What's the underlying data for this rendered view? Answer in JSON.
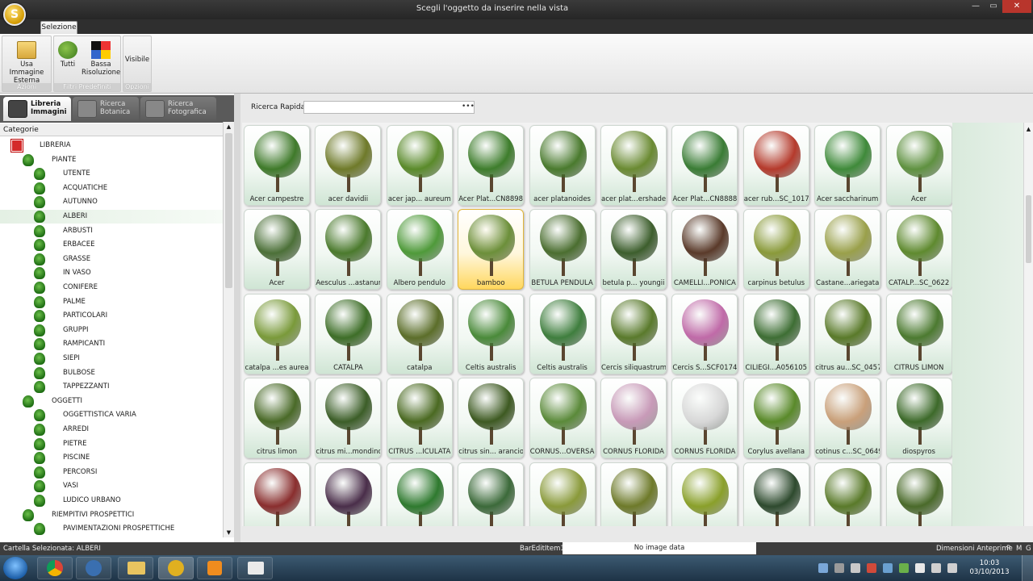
{
  "window": {
    "title": "Scegli l'oggetto da inserire nella vista",
    "min": "—",
    "max": "▭",
    "close": "✕"
  },
  "ribbon": {
    "tab": "Selezione",
    "groups": [
      {
        "label": "Azioni",
        "buttons": [
          {
            "label_1": "Usa Immagine",
            "label_2": "Esterna",
            "icon": "folder-icon"
          }
        ]
      },
      {
        "label": "Filtri Predefiniti",
        "buttons": [
          {
            "label_1": "Tutti",
            "label_2": "",
            "icon": "plants-icon"
          },
          {
            "label_1": "Bassa",
            "label_2": "Risoluzione",
            "icon": "pixel-grid-icon"
          }
        ]
      },
      {
        "label": "Opzioni",
        "buttons": [
          {
            "label_1": "Visibile",
            "label_2": "",
            "icon": "eye-icon"
          }
        ]
      }
    ]
  },
  "panel_tabs": [
    {
      "line_1": "Libreria",
      "line_2": "Immagini",
      "active": true
    },
    {
      "line_1": "Ricerca",
      "line_2": "Botanica",
      "active": false
    },
    {
      "line_1": "Ricerca",
      "line_2": "Fotografica",
      "active": false
    }
  ],
  "tree": {
    "header": "Categorie",
    "root": "LIBRERIA",
    "nodes": [
      {
        "label": "PIANTE",
        "level": 1
      },
      {
        "label": "UTENTE",
        "level": 2
      },
      {
        "label": "ACQUATICHE",
        "level": 2
      },
      {
        "label": "AUTUNNO",
        "level": 2
      },
      {
        "label": "ALBERI",
        "level": 2,
        "selected": true
      },
      {
        "label": "ARBUSTI",
        "level": 2
      },
      {
        "label": "ERBACEE",
        "level": 2
      },
      {
        "label": "GRASSE",
        "level": 2
      },
      {
        "label": "IN VASO",
        "level": 2
      },
      {
        "label": "CONIFERE",
        "level": 2
      },
      {
        "label": "PALME",
        "level": 2
      },
      {
        "label": "PARTICOLARI",
        "level": 2
      },
      {
        "label": "GRUPPI",
        "level": 2
      },
      {
        "label": "RAMPICANTI",
        "level": 2
      },
      {
        "label": "SIEPI",
        "level": 2
      },
      {
        "label": "BULBOSE",
        "level": 2
      },
      {
        "label": "TAPPEZZANTI",
        "level": 2
      },
      {
        "label": "OGGETTI",
        "level": 1
      },
      {
        "label": "OGGETTISTICA VARIA",
        "level": 2
      },
      {
        "label": "ARREDI",
        "level": 2
      },
      {
        "label": "PIETRE",
        "level": 2
      },
      {
        "label": "PISCINE",
        "level": 2
      },
      {
        "label": "PERCORSI",
        "level": 2
      },
      {
        "label": "VASI",
        "level": 2
      },
      {
        "label": "LUDICO URBANO",
        "level": 2
      },
      {
        "label": "RIEMPITIVI PROSPETTICI",
        "level": 1
      },
      {
        "label": "PAVIMENTAZIONI PROSPETTICHE",
        "level": 2
      }
    ]
  },
  "search": {
    "label": "Ricerca Rapida",
    "value": "",
    "dots": "•••"
  },
  "grid": {
    "cards": [
      {
        "label": "Acer campestre",
        "color": "#3f7a2a"
      },
      {
        "label": "acer davidii",
        "color": "#6f7a2a"
      },
      {
        "label": "acer jap... aureum",
        "color": "#5a8a2a"
      },
      {
        "label": "Acer Plat...CN8898",
        "color": "#3e7d2c"
      },
      {
        "label": "acer platanoides",
        "color": "#4a7a2e"
      },
      {
        "label": "acer plat...ershade",
        "color": "#6a8a32"
      },
      {
        "label": "Acer Plat...CN8888",
        "color": "#3a7c35"
      },
      {
        "label": "acer rub...SC_1017",
        "color": "#b53a2c"
      },
      {
        "label": "Acer saccharinum",
        "color": "#3f8a3a"
      },
      {
        "label": "Acer",
        "color": "#5f9140"
      },
      {
        "label": "Acer",
        "color": "#4c7038"
      },
      {
        "label": "Aesculus ...astanum",
        "color": "#4b7a2d"
      },
      {
        "label": "Albero pendulo",
        "color": "#4f9a3a"
      },
      {
        "label": "bamboo",
        "color": "#6c8f3a",
        "selected": true
      },
      {
        "label": "BETULA PENDULA",
        "color": "#4b6e30"
      },
      {
        "label": "betula p... youngii",
        "color": "#3d5e2d"
      },
      {
        "label": "CAMELLI...PONICA",
        "color": "#5a3a2a"
      },
      {
        "label": "carpinus betulus",
        "color": "#8a9a3a"
      },
      {
        "label": "Castane...ariegata",
        "color": "#9aa04a"
      },
      {
        "label": "CATALP...SC_0622",
        "color": "#5f8a2f"
      },
      {
        "label": "catalpa ...es aurea",
        "color": "#7a9a3a"
      },
      {
        "label": "CATALPA",
        "color": "#3e6e28"
      },
      {
        "label": "catalpa",
        "color": "#5c6e2a"
      },
      {
        "label": "Celtis australis",
        "color": "#4a8a3a"
      },
      {
        "label": "Celtis australis",
        "color": "#3f7e3e"
      },
      {
        "label": "Cercis siliquastrum",
        "color": "#5a7a2c"
      },
      {
        "label": "Cercis S...SCF0174",
        "color": "#c06aa8"
      },
      {
        "label": "CILIEGI...A056105",
        "color": "#3e6e34"
      },
      {
        "label": "citrus au...SC_0457",
        "color": "#5a7a2a"
      },
      {
        "label": "CITRUS LIMON",
        "color": "#4c7a30"
      },
      {
        "label": "citrus limon",
        "color": "#4a6a28"
      },
      {
        "label": "citrus mi...mondino",
        "color": "#3c5e28"
      },
      {
        "label": "CITRUS ...ICULATA",
        "color": "#4b6a22"
      },
      {
        "label": "citrus sin... arancio",
        "color": "#3e5a22"
      },
      {
        "label": "CORNUS...OVERSA",
        "color": "#5b8a3a"
      },
      {
        "label": "CORNUS FLORIDA",
        "color": "#c89ab8"
      },
      {
        "label": "CORNUS FLORIDA",
        "color": "#d8d8d8"
      },
      {
        "label": "Corylus avellana",
        "color": "#5a8a2a"
      },
      {
        "label": "cotinus c...SC_0649",
        "color": "#c9a07a"
      },
      {
        "label": "diospyros",
        "color": "#3d6a2a"
      },
      {
        "label": "",
        "color": "#8a2e2e"
      },
      {
        "label": "",
        "color": "#4a2e4a"
      },
      {
        "label": "",
        "color": "#2f7a2f"
      },
      {
        "label": "",
        "color": "#3c6a3a"
      },
      {
        "label": "",
        "color": "#8a9a3a"
      },
      {
        "label": "",
        "color": "#6e7a2a"
      },
      {
        "label": "",
        "color": "#8aa02a"
      },
      {
        "label": "",
        "color": "#2e4a2e"
      },
      {
        "label": "",
        "color": "#5a7a2a"
      },
      {
        "label": "",
        "color": "#4a6a2a"
      }
    ]
  },
  "status": {
    "folder": "Cartella Selezionata: ALBERI",
    "bar_item": "BarEditItem1",
    "image_data": "No image data",
    "dim_label": "Dimensioni Anteprime",
    "size_p": "P",
    "size_m": "M",
    "size_g": "G"
  },
  "taskbar": {
    "time": "10:03",
    "date": "03/10/2013"
  }
}
